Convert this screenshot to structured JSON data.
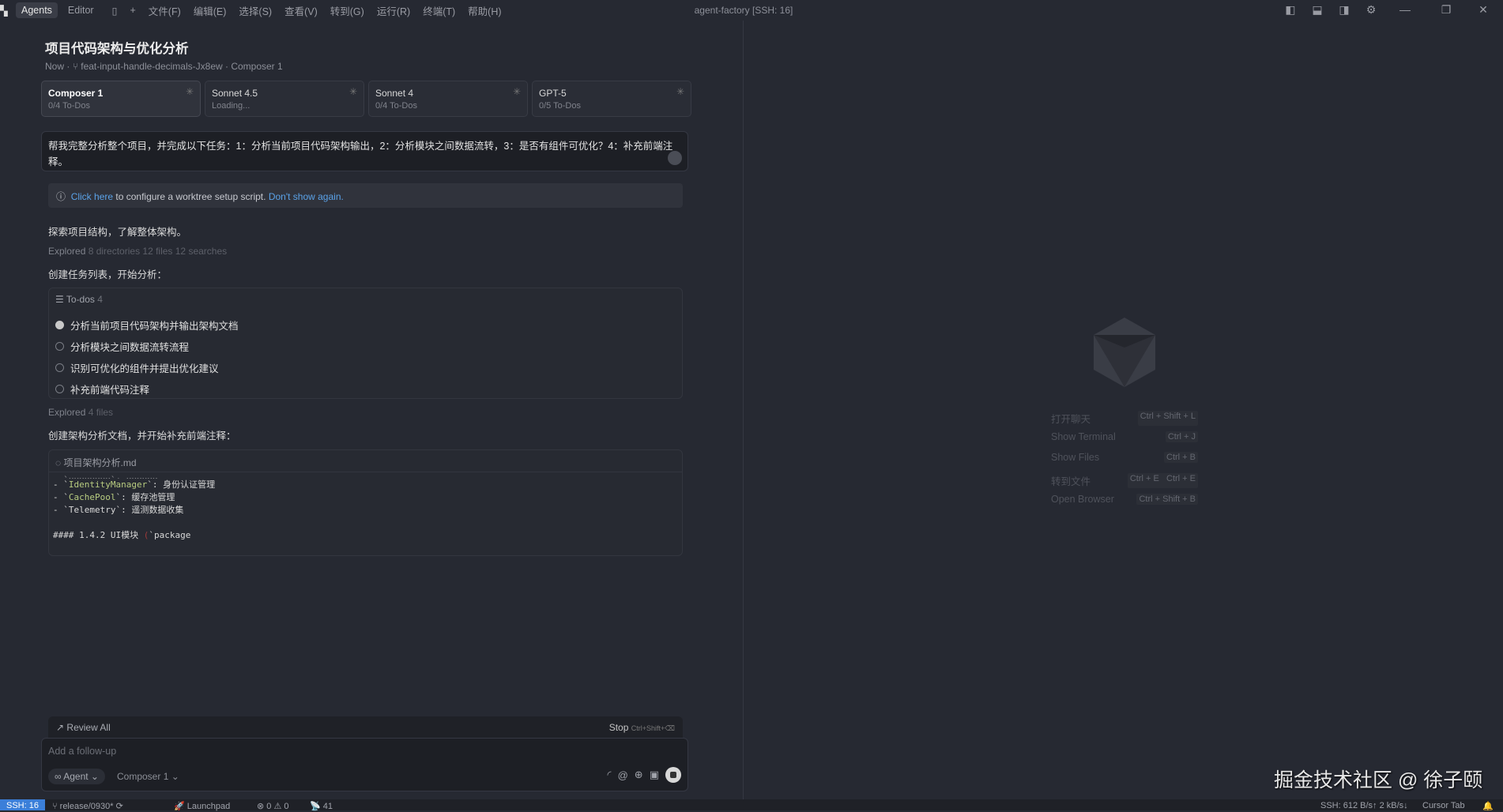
{
  "menubar": {
    "tabs": [
      "Agents",
      "Editor"
    ],
    "items": [
      "文件(F)",
      "编辑(E)",
      "选择(S)",
      "查看(V)",
      "转到(G)",
      "运行(R)",
      "终端(T)",
      "帮助(H)"
    ],
    "window_title": "agent-factory [SSH: 16]"
  },
  "header": {
    "title": "项目代码架构与优化分析",
    "subtitle_time": "Now",
    "branch": "feat-input-handle-decimals-Jx8ew",
    "model": "Composer 1"
  },
  "cards": [
    {
      "name": "Composer 1",
      "status": "0/4 To-Dos"
    },
    {
      "name": "Sonnet 4.5",
      "status": "Loading..."
    },
    {
      "name": "Sonnet 4",
      "status": "0/4 To-Dos"
    },
    {
      "name": "GPT-5",
      "status": "0/5 To-Dos"
    }
  ],
  "prompt": "帮我完整分析整个项目，并完成以下任务：1：分析当前项目代码架构输出，2：分析模块之间数据流转，3：是否有组件可优化？4：补充前端注释。",
  "banner": {
    "link1": "Click here",
    "text": " to configure a worktree setup script. ",
    "link2": "Don't show again."
  },
  "chat": {
    "msg1": "探索项目结构，了解整体架构。",
    "explored1_label": "Explored",
    "explored1_detail": " 8 directories 12 files 12 searches",
    "msg2": "创建任务列表，开始分析：",
    "explored2_label": "Explored",
    "explored2_detail": " 4 files",
    "msg3": "创建架构分析文档，并开始补充前端注释："
  },
  "todos": {
    "title": "To-dos",
    "count": "4",
    "items": [
      {
        "label": "分析当前项目代码架构并输出架构文档",
        "state": "in-progress"
      },
      {
        "label": "分析模块之间数据流转流程",
        "state": "pending"
      },
      {
        "label": "识别可优化的组件并提出优化建议",
        "state": "pending"
      },
      {
        "label": "补充前端代码注释",
        "state": "pending"
      }
    ]
  },
  "file": {
    "name": "项目架构分析.md",
    "lines": [
      {
        "pre": "- `",
        "id": "IdentityManager",
        "post": "`: 身份认证管理"
      },
      {
        "pre": "- `",
        "id": "CachePool",
        "post": "`: 缓存池管理"
      },
      {
        "pre": "- `Telemetry",
        "id": "",
        "post": "`: 遥测数据收集"
      }
    ],
    "heading": "#### 1.4.2 UI模块 ",
    "heading_paren": "(",
    "heading_tail": "`package"
  },
  "review": {
    "label": "Review All",
    "stop": "Stop",
    "stop_shortcut": "Ctrl+Shift+⌫"
  },
  "input": {
    "placeholder": "Add a follow-up",
    "mode": "Agent",
    "model": "Composer 1"
  },
  "shortcuts": [
    {
      "label": "打开聊天",
      "keys": "Ctrl + Shift + L"
    },
    {
      "label": "Show Terminal",
      "keys": "Ctrl + J"
    },
    {
      "label": "Show Files",
      "keys": "Ctrl + B"
    },
    {
      "label": "转到文件",
      "keys": "Ctrl + E   Ctrl + E"
    },
    {
      "label": "Open Browser",
      "keys": "Ctrl + Shift + B"
    }
  ],
  "watermark": "掘金技术社区 @ 徐子颐",
  "status": {
    "remote": "SSH: 16",
    "branch": "release/0930*",
    "launchpad": "Launchpad",
    "problems": "⊗ 0 ⚠ 0",
    "ports": "41",
    "net": "SSH: 612 B/s↑ 2 kB/s↓",
    "cursor_tab": "Cursor Tab"
  }
}
